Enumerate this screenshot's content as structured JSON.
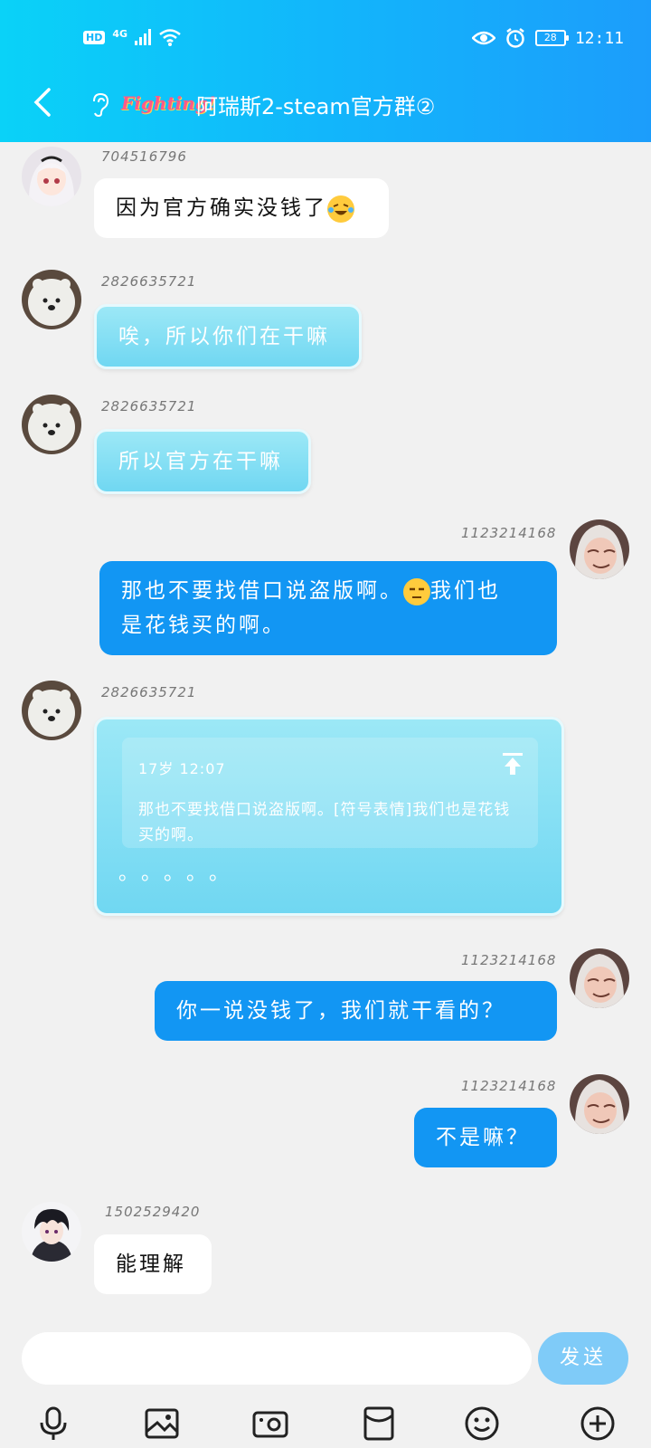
{
  "status_bar": {
    "hd": "HD",
    "network": "4G",
    "battery": "28",
    "time": "12:11"
  },
  "header": {
    "back_label": "‹",
    "brand_logo_text": "Fighting!",
    "title": "阿瑞斯2-steam官方群②"
  },
  "messages": [
    {
      "uid": "704516796",
      "text": "因为官方确实没钱了",
      "emoji": "laughing-crying-emoji"
    },
    {
      "uid": "2826635721",
      "text": "唉，所以你们在干嘛"
    },
    {
      "uid": "2826635721",
      "text": "所以官方在干嘛"
    },
    {
      "uid": "1123214168",
      "line1": "那也不要找借口说盗版啊。",
      "emoji": "unamused-emoji",
      "line1b": "我们也",
      "line2": "是花钱买的啊。"
    },
    {
      "uid": "2826635721",
      "quote_meta": "17岁  12:07",
      "quote_text": "那也不要找借口说盗版啊。[符号表情]我们也是花钱买的啊。",
      "dots": "。。。。。"
    },
    {
      "uid": "1123214168",
      "text": "你一说没钱了，我们就干看的？"
    },
    {
      "uid": "1123214168",
      "text": "不是嘛？"
    },
    {
      "uid": "1502529420",
      "text": "能理解"
    }
  ],
  "input": {
    "placeholder": "",
    "send_label": "发送"
  },
  "toolbar": [
    "microphone-icon",
    "image-icon",
    "camera-icon",
    "red-packet-icon",
    "emoji-icon",
    "plus-icon"
  ],
  "colors": {
    "header_start": "#0ad2f8",
    "header_end": "#1c9dfb",
    "own_bubble": "#1296f3",
    "cyan_bubble": "#70d7f2",
    "send_button": "#7fcbf8"
  }
}
